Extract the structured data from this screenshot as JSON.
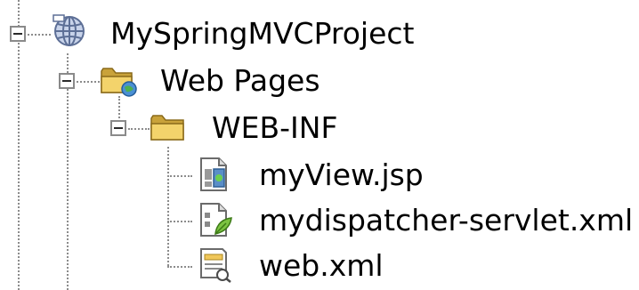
{
  "tree": {
    "project": {
      "label": "MySpringMVCProject",
      "icon": "web-project-globe-icon",
      "expanded": true
    },
    "web_pages": {
      "label": "Web Pages",
      "icon": "web-pages-folder-icon",
      "expanded": true
    },
    "web_inf": {
      "label": "WEB-INF",
      "icon": "folder-icon",
      "expanded": true
    },
    "files": [
      {
        "label": "myView.jsp",
        "icon": "jsp-file-icon"
      },
      {
        "label": "mydispatcher-servlet.xml",
        "icon": "xml-config-file-icon"
      },
      {
        "label": "web.xml",
        "icon": "web-xml-file-icon"
      }
    ]
  },
  "colors": {
    "folder": "#f3d36b",
    "folder_dark": "#c9a23a",
    "globe": "#7c96c4",
    "text": "#000000",
    "tree_line": "#8c8c8c"
  }
}
